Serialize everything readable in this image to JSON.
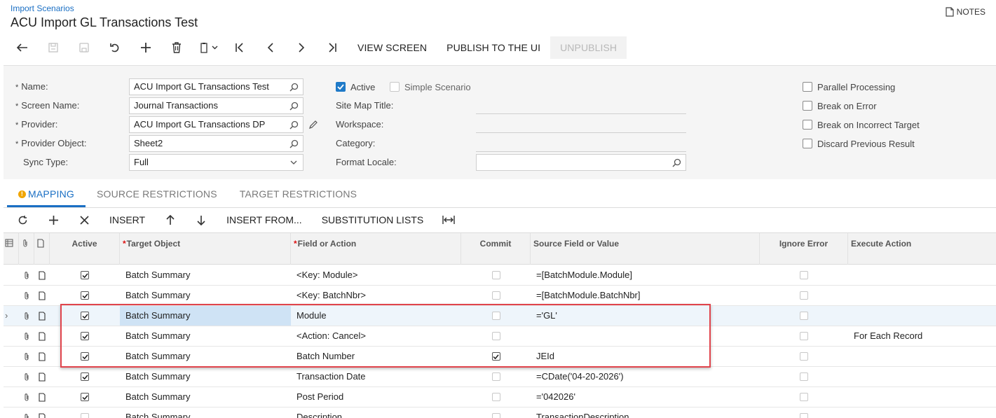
{
  "header": {
    "breadcrumb": "Import Scenarios",
    "title": "ACU Import GL Transactions Test",
    "notes_label": "NOTES"
  },
  "toolbar": {
    "view_screen": "VIEW SCREEN",
    "publish": "PUBLISH TO THE UI",
    "unpublish": "UNPUBLISH"
  },
  "form": {
    "name_label": "Name:",
    "name_value": "ACU Import GL Transactions Test",
    "screen_label": "Screen Name:",
    "screen_value": "Journal Transactions",
    "provider_label": "Provider:",
    "provider_value": "ACU Import GL Transactions DP",
    "provider_object_label": "Provider Object:",
    "provider_object_value": "Sheet2",
    "sync_label": "Sync Type:",
    "sync_value": "Full",
    "active_label": "Active",
    "active_checked": true,
    "simple_label": "Simple Scenario",
    "simple_checked": false,
    "sitemap_label": "Site Map Title:",
    "workspace_label": "Workspace:",
    "category_label": "Category:",
    "locale_label": "Format Locale:",
    "parallel_label": "Parallel Processing",
    "break_error_label": "Break on Error",
    "break_target_label": "Break on Incorrect Target",
    "discard_label": "Discard Previous Result"
  },
  "tabs": {
    "mapping": "MAPPING",
    "source": "SOURCE RESTRICTIONS",
    "target": "TARGET RESTRICTIONS"
  },
  "grid_toolbar": {
    "insert": "INSERT",
    "insert_from": "INSERT FROM...",
    "substitution": "SUBSTITUTION LISTS"
  },
  "grid": {
    "columns": {
      "active": "Active",
      "target_object": "Target Object",
      "field_or_action": "Field or Action",
      "commit": "Commit",
      "source_field": "Source Field or Value",
      "ignore_error": "Ignore Error",
      "execute_action": "Execute Action"
    },
    "rows": [
      {
        "active": true,
        "target": "Batch Summary",
        "field": "<Key: Module>",
        "commit": false,
        "source": "=[BatchModule.Module]",
        "ignore": false,
        "action": ""
      },
      {
        "active": true,
        "target": "Batch Summary",
        "field": "<Key: BatchNbr>",
        "commit": false,
        "source": "=[BatchModule.BatchNbr]",
        "ignore": false,
        "action": ""
      },
      {
        "active": true,
        "target": "Batch Summary",
        "field": "Module",
        "commit": false,
        "source": "='GL'",
        "ignore": false,
        "action": ""
      },
      {
        "active": true,
        "target": "Batch Summary",
        "field": "<Action: Cancel>",
        "commit": false,
        "source": "",
        "ignore": false,
        "action": "For Each Record"
      },
      {
        "active": true,
        "target": "Batch Summary",
        "field": "Batch Number",
        "commit": true,
        "source": "JEId",
        "ignore": false,
        "action": ""
      },
      {
        "active": true,
        "target": "Batch Summary",
        "field": "Transaction Date",
        "commit": false,
        "source": "=CDate('04-20-2026')",
        "ignore": false,
        "action": ""
      },
      {
        "active": true,
        "target": "Batch Summary",
        "field": "Post Period",
        "commit": false,
        "source": "='042026'",
        "ignore": false,
        "action": ""
      },
      {
        "active": false,
        "target": "Batch Summary",
        "field": "Description",
        "commit": false,
        "source": "TransactionDescription",
        "ignore": false,
        "action": ""
      }
    ]
  },
  "colors": {
    "accent": "#1a6fc4",
    "highlight_box": "#e0444c",
    "selected_row": "#eef5fb",
    "selected_cell": "#cfe3f5"
  }
}
